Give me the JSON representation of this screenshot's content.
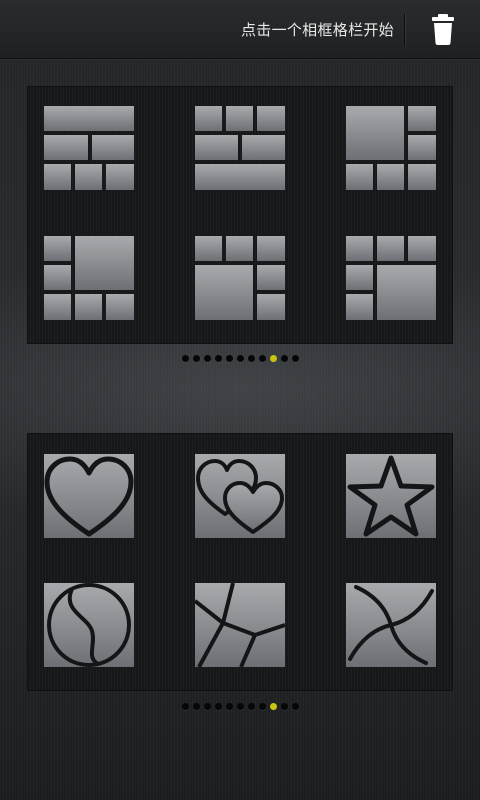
{
  "header": {
    "hint_text": "点击一个相框格栏开始",
    "delete_icon": "trash-icon"
  },
  "colors": {
    "cell_top": "#a8abae",
    "cell_bottom": "#6c7074",
    "panel_bg": "#151719",
    "page_dot": "#060606",
    "page_dot_active": "#c8c410"
  },
  "grid_templates": [
    {
      "name": "layout-template-1",
      "icon": "grid-layout-icon"
    },
    {
      "name": "layout-template-2",
      "icon": "grid-layout-icon"
    },
    {
      "name": "layout-template-3",
      "icon": "grid-layout-icon"
    },
    {
      "name": "layout-template-4",
      "icon": "grid-layout-icon"
    },
    {
      "name": "layout-template-5",
      "icon": "grid-layout-icon"
    },
    {
      "name": "layout-template-6",
      "icon": "grid-layout-icon"
    }
  ],
  "shape_templates": [
    {
      "name": "heart-frame",
      "icon": "heart-icon"
    },
    {
      "name": "double-heart-frame",
      "icon": "double-heart-icon"
    },
    {
      "name": "star-frame",
      "icon": "star-icon"
    },
    {
      "name": "yin-yang-frame",
      "icon": "yin-yang-icon"
    },
    {
      "name": "geometric-frame",
      "icon": "geometric-split-icon"
    },
    {
      "name": "pinwheel-frame",
      "icon": "pinwheel-icon"
    }
  ],
  "pager_top": {
    "total": 11,
    "active_index": 8
  },
  "pager_bottom": {
    "total": 11,
    "active_index": 8
  }
}
